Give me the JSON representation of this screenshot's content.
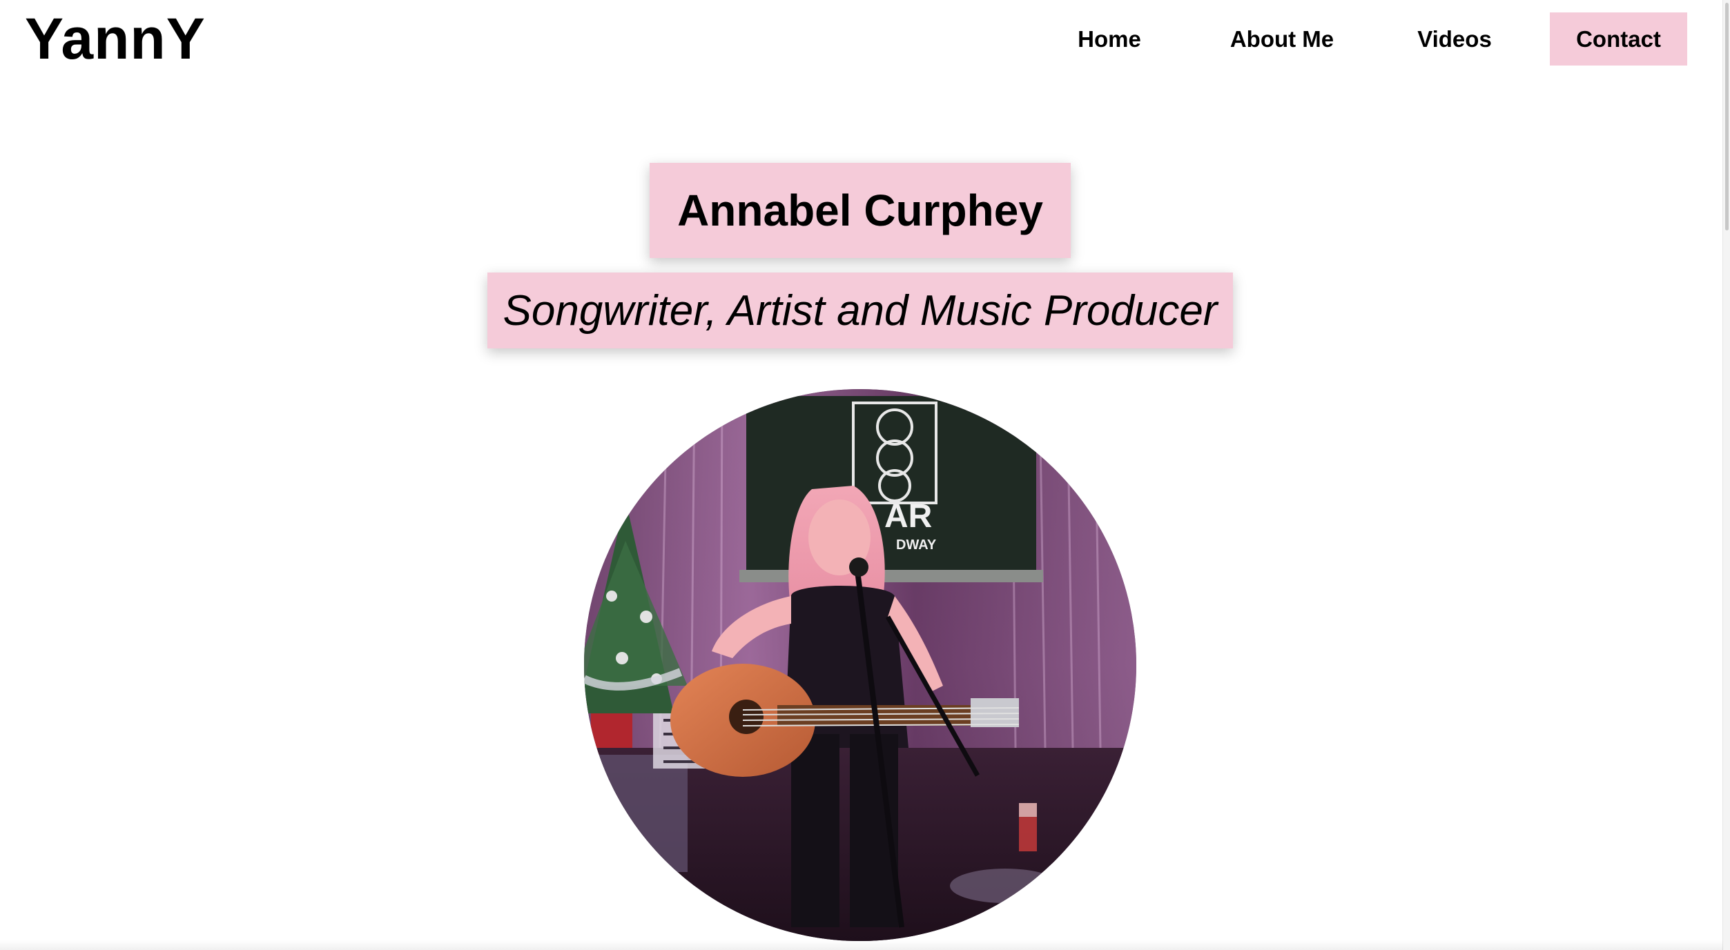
{
  "site": {
    "logo": "YannY"
  },
  "nav": {
    "items": [
      {
        "label": "Home"
      },
      {
        "label": "About Me"
      },
      {
        "label": "Videos"
      },
      {
        "label": "Contact"
      }
    ],
    "active_highlight_color": "#f5cbd9"
  },
  "hero": {
    "name": "Annabel Curphey",
    "tagline": "Songwriter, Artist and Music Producer",
    "box_color": "#f5cbd9"
  },
  "photo": {
    "sign_text": "AR",
    "sign_subtext": "DWAY"
  }
}
